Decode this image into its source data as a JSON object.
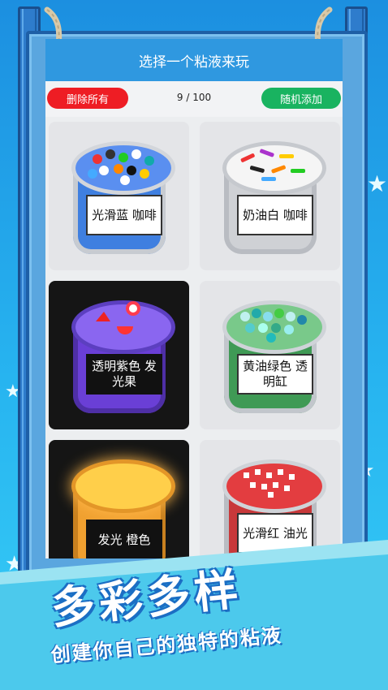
{
  "header": {
    "title": "选择一个粘液来玩"
  },
  "toolbar": {
    "delete_all_label": "删除所有",
    "counter": "9 / 100",
    "random_add_label": "随机添加"
  },
  "slimes": [
    {
      "name": "光滑蓝 咖啡",
      "color": "#3f7fe0",
      "theme": "light"
    },
    {
      "name": "奶油白 咖啡",
      "color": "#d8dadd",
      "theme": "light"
    },
    {
      "name": "透明紫色 发光果",
      "color": "#6a3fd6",
      "theme": "dark"
    },
    {
      "name": "黄油绿色 透明缸",
      "color": "#3f9a55",
      "theme": "light"
    },
    {
      "name": "发光 橙色",
      "color": "#f0a030",
      "theme": "dark"
    },
    {
      "name": "光滑红 油光",
      "color": "#c8383a",
      "theme": "light"
    }
  ],
  "banner": {
    "headline": "多彩多样",
    "subtitle": "创建你自己的独特的粘液"
  },
  "colors": {
    "title_bar": "#2f98e0",
    "delete_button": "#ee1d24",
    "add_button": "#19b360",
    "background": "#27b4f0"
  }
}
